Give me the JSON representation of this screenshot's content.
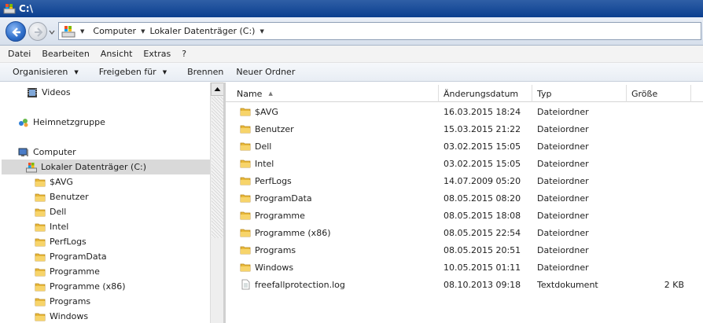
{
  "window": {
    "title": "C:\\"
  },
  "address": {
    "crumbs": [
      {
        "label": "Computer"
      },
      {
        "label": "Lokaler Datenträger (C:)"
      }
    ]
  },
  "menu": [
    "Datei",
    "Bearbeiten",
    "Ansicht",
    "Extras",
    "?"
  ],
  "commands": {
    "organize": "Organisieren",
    "share": "Freigeben für",
    "burn": "Brennen",
    "new_folder": "Neuer Ordner"
  },
  "nav": {
    "videos": "Videos",
    "homegroup": "Heimnetzgruppe",
    "computer": "Computer",
    "drive": "Lokaler Datenträger (C:)",
    "folders": [
      "$AVG",
      "Benutzer",
      "Dell",
      "Intel",
      "PerfLogs",
      "ProgramData",
      "Programme",
      "Programme (x86)",
      "Programs",
      "Windows"
    ]
  },
  "columns": {
    "name": "Name",
    "date": "Änderungsdatum",
    "type": "Typ",
    "size": "Größe"
  },
  "files": [
    {
      "name": "$AVG",
      "date": "16.03.2015 18:24",
      "type": "Dateiordner",
      "size": "",
      "icon": "folder-icon"
    },
    {
      "name": "Benutzer",
      "date": "15.03.2015 21:22",
      "type": "Dateiordner",
      "size": "",
      "icon": "folder-icon"
    },
    {
      "name": "Dell",
      "date": "03.02.2015 15:05",
      "type": "Dateiordner",
      "size": "",
      "icon": "folder-icon"
    },
    {
      "name": "Intel",
      "date": "03.02.2015 15:05",
      "type": "Dateiordner",
      "size": "",
      "icon": "folder-icon"
    },
    {
      "name": "PerfLogs",
      "date": "14.07.2009 05:20",
      "type": "Dateiordner",
      "size": "",
      "icon": "folder-icon"
    },
    {
      "name": "ProgramData",
      "date": "08.05.2015 08:20",
      "type": "Dateiordner",
      "size": "",
      "icon": "folder-icon"
    },
    {
      "name": "Programme",
      "date": "08.05.2015 18:08",
      "type": "Dateiordner",
      "size": "",
      "icon": "folder-icon"
    },
    {
      "name": "Programme (x86)",
      "date": "08.05.2015 22:54",
      "type": "Dateiordner",
      "size": "",
      "icon": "folder-icon"
    },
    {
      "name": "Programs",
      "date": "08.05.2015 20:51",
      "type": "Dateiordner",
      "size": "",
      "icon": "folder-icon"
    },
    {
      "name": "Windows",
      "date": "10.05.2015 01:11",
      "type": "Dateiordner",
      "size": "",
      "icon": "folder-icon"
    },
    {
      "name": "freefallprotection.log",
      "date": "08.10.2013 09:18",
      "type": "Textdokument",
      "size": "2 KB",
      "icon": "text-file-icon"
    }
  ]
}
